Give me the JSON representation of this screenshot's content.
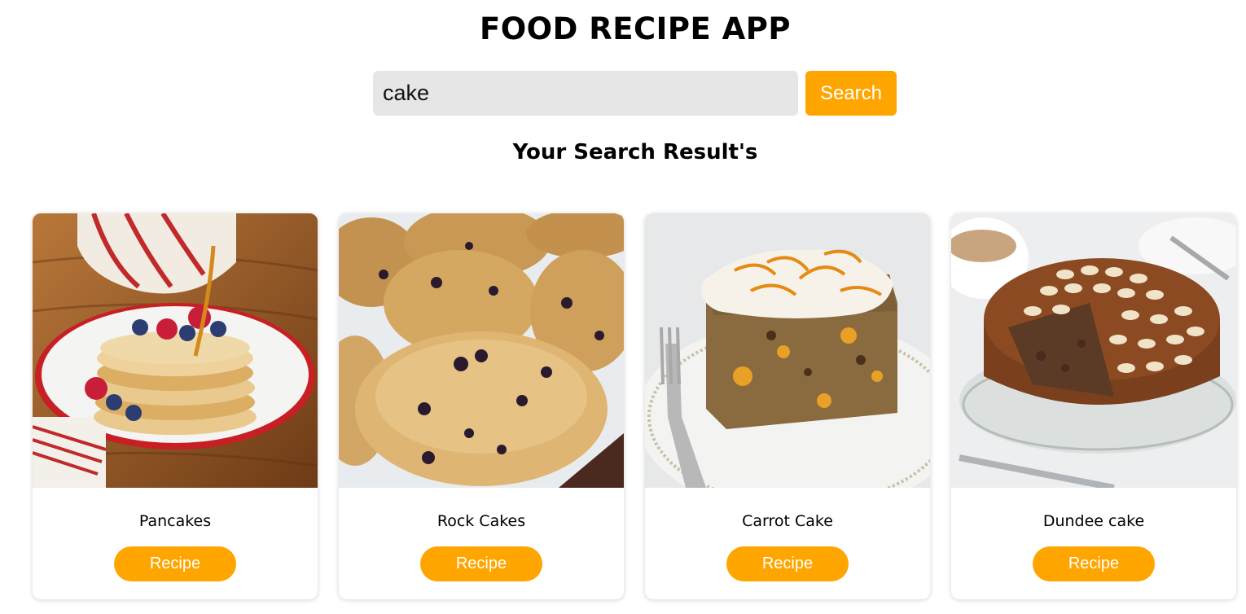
{
  "app": {
    "title": "FOOD RECIPE APP"
  },
  "search": {
    "value": "cake",
    "button_label": "Search"
  },
  "results": {
    "heading": "Your Search Result's",
    "items": [
      {
        "name": "Pancakes",
        "button_label": "Recipe",
        "image": "pancakes-photo"
      },
      {
        "name": "Rock Cakes",
        "button_label": "Recipe",
        "image": "rock-cakes-photo"
      },
      {
        "name": "Carrot Cake",
        "button_label": "Recipe",
        "image": "carrot-cake-photo"
      },
      {
        "name": "Dundee cake",
        "button_label": "Recipe",
        "image": "dundee-cake-photo"
      }
    ]
  },
  "colors": {
    "accent": "#ffa500",
    "input_bg": "#e6e6e6"
  }
}
